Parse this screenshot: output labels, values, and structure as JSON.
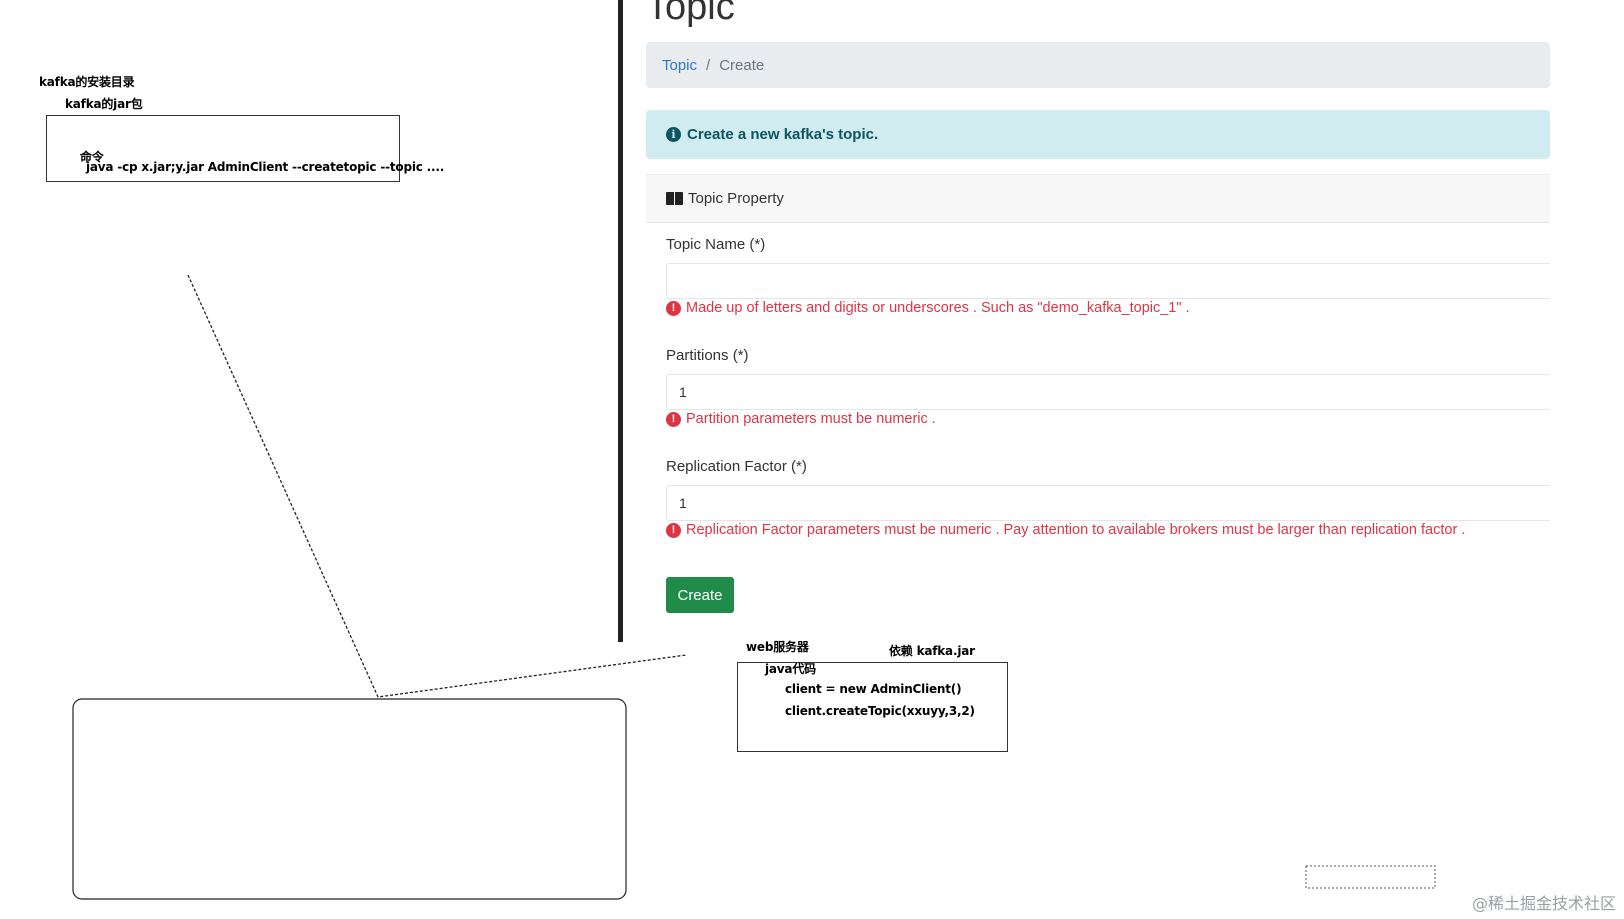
{
  "whiteboard": {
    "kafka_install_dir": "kafka的安装目录",
    "kafka_jar": "kafka的jar包",
    "command_label": "命令",
    "command_text": "java -cp  x.jar;y.jar   AdminClient --createtopic  --topic ....",
    "web_server": "web服务器",
    "depends": "依赖 kafka.jar",
    "java_code": "java代码",
    "code_line_1": "client = new AdminClient()",
    "code_line_2": "client.createTopic(xxuyy,3,2)"
  },
  "app": {
    "page_title": "Topic",
    "breadcrumb": {
      "link": "Topic",
      "separator": "/",
      "current": "Create"
    },
    "alert": {
      "icon": "info-icon",
      "text": "Create a new kafka's topic."
    },
    "card": {
      "header_icon": "book-icon",
      "header": "Topic Property",
      "fields": [
        {
          "label": "Topic Name (*)",
          "value": "",
          "hint": "Made up of letters and digits or underscores . Such as \"demo_kafka_topic_1\" ."
        },
        {
          "label": "Partitions (*)",
          "value": "1",
          "hint": "Partition parameters must be numeric ."
        },
        {
          "label": "Replication Factor (*)",
          "value": "1",
          "hint": "Replication Factor parameters must be numeric . Pay attention to available brokers must be larger than replication factor ."
        }
      ],
      "create_button": "Create"
    }
  },
  "watermark": "@稀土掘金技术社区",
  "colors": {
    "link": "#2a76d2",
    "alert_bg": "#d1ecf1",
    "alert_text": "#0c5460",
    "error": "#dc3545",
    "button": "#218c4a"
  }
}
